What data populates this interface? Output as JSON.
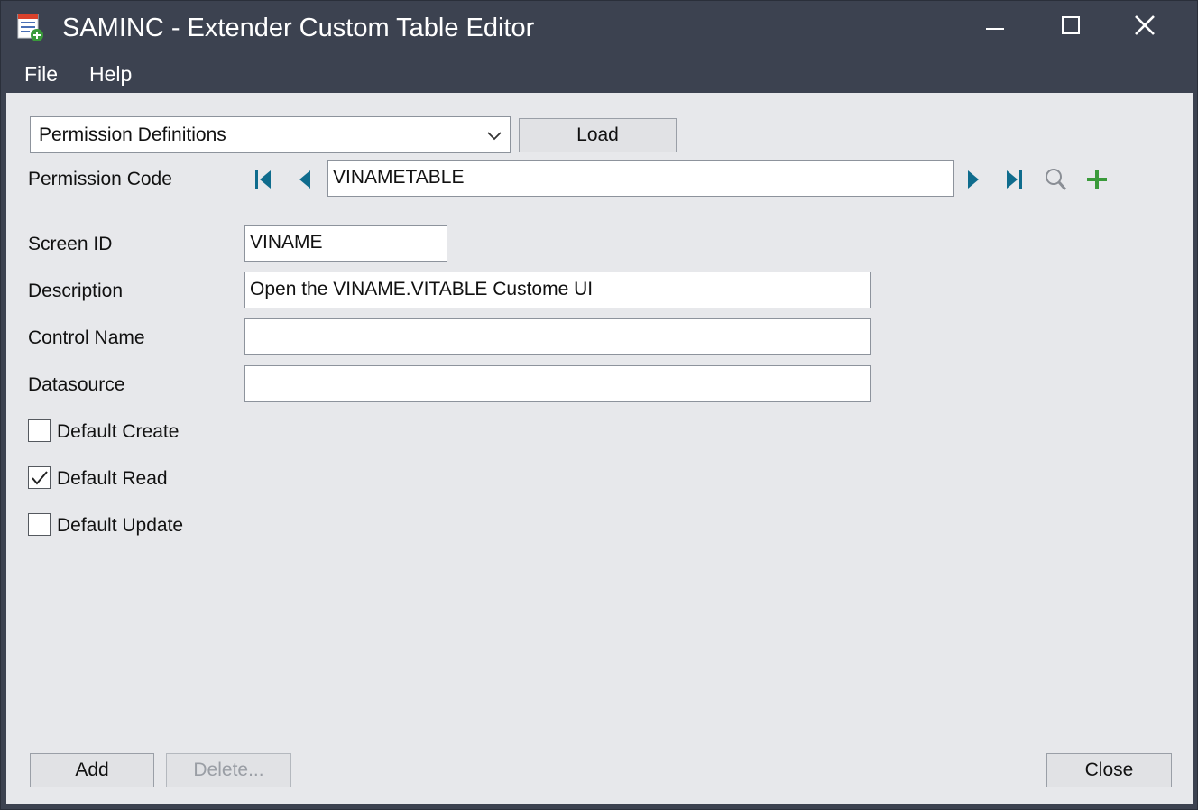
{
  "window": {
    "title": "SAMINC - Extender Custom Table Editor",
    "icon": "table-editor-icon"
  },
  "menu": {
    "file": "File",
    "help": "Help"
  },
  "table_select": {
    "value": "Permission Definitions",
    "load_label": "Load"
  },
  "record_nav": {
    "label": "Permission Code",
    "value": "VINAMETABLE",
    "icons": [
      "first-record-icon",
      "previous-record-icon",
      "next-record-icon",
      "last-record-icon",
      "search-icon",
      "add-icon"
    ]
  },
  "fields": {
    "screen_id": {
      "label": "Screen ID",
      "value": "VINAME"
    },
    "description": {
      "label": "Description",
      "value": "Open the VINAME.VITABLE Custome UI"
    },
    "control_name": {
      "label": "Control Name",
      "value": ""
    },
    "datasource": {
      "label": "Datasource",
      "value": ""
    }
  },
  "checkboxes": {
    "default_create": {
      "label": "Default Create",
      "checked": false
    },
    "default_read": {
      "label": "Default Read",
      "checked": true
    },
    "default_update": {
      "label": "Default Update",
      "checked": false
    }
  },
  "buttons": {
    "add": "Add",
    "delete": "Delete...",
    "close": "Close"
  },
  "colors": {
    "titlebar": "#3c4250",
    "client_bg": "#e7e8eb",
    "nav_accent": "#0f6c8d",
    "add_green": "#3a9a3a"
  }
}
